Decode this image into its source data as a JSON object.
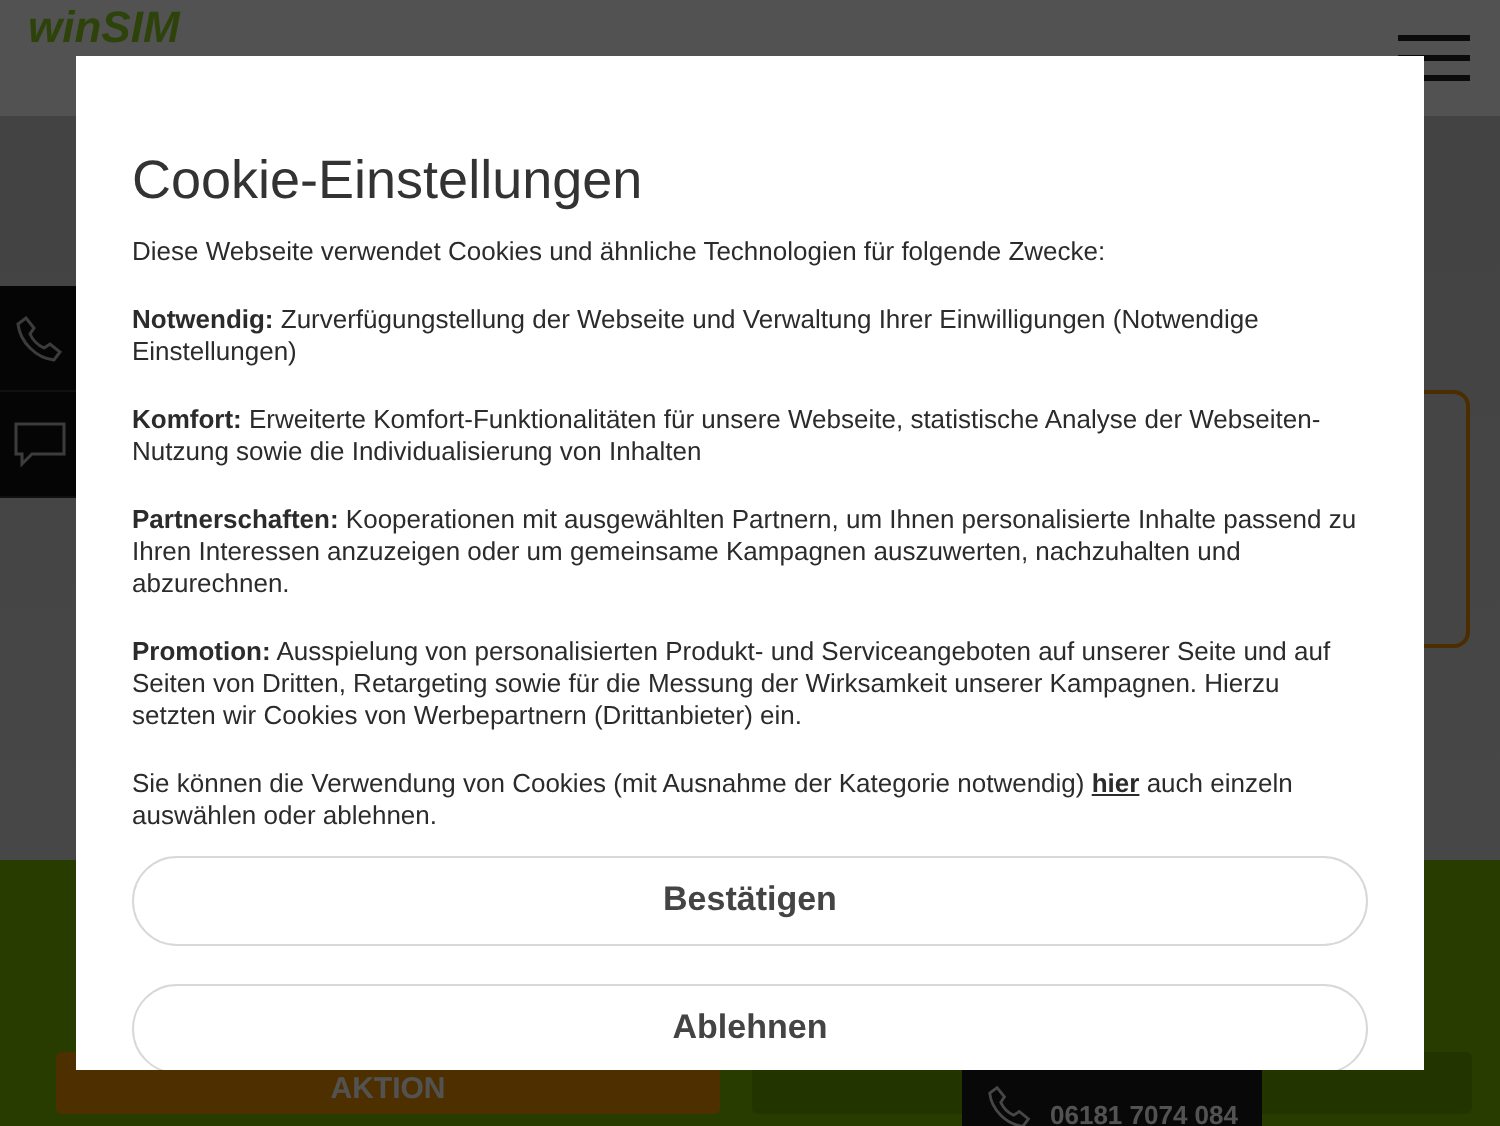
{
  "header": {
    "logo": "winSIM"
  },
  "page": {
    "promo_button": "AKTION",
    "hotline": "06181 7074 084"
  },
  "cookie_dialog": {
    "title": "Cookie-Einstellungen",
    "intro": "Diese Webseite verwendet Cookies und ähnliche Technologien für folgende Zwecke:",
    "sections": [
      {
        "text": "**Notwendig:** Zurverfügungstellung der Webseite und Verwaltung Ihrer Einwilligungen (Notwendige Einstellungen)"
      },
      {
        "text": "**Komfort:** Erweiterte Komfort-Funktionalitäten für unsere Webseite, statistische Analyse der Webseiten-Nutzung sowie die Individualisierung von Inhalten"
      },
      {
        "text": "**Partnerschaften:** Kooperationen mit ausgewählten Partnern, um Ihnen personalisierte Inhalte passend zu Ihren Interessen anzuzeigen oder um gemeinsame Kampagnen auszuwerten, nachzuhalten und abzurechnen."
      },
      {
        "text": "**Promotion:** Ausspielung von personalisierten Produkt- und Serviceangeboten auf unserer Seite und auf Seiten von Dritten, Retargeting sowie für die Messung der Wirksamkeit unserer Kampagnen. Hierzu setzten wir Cookies von Werbepartnern (Drittanbieter) ein."
      }
    ],
    "footer": {
      "before": "Sie können die Verwendung von Cookies (mit Ausnahme der Kategorie notwendig) ",
      "link": "hier",
      "after": " auch einzeln auswählen oder ablehnen."
    },
    "buttons": [
      "Bestätigen",
      "Ablehnen"
    ]
  }
}
